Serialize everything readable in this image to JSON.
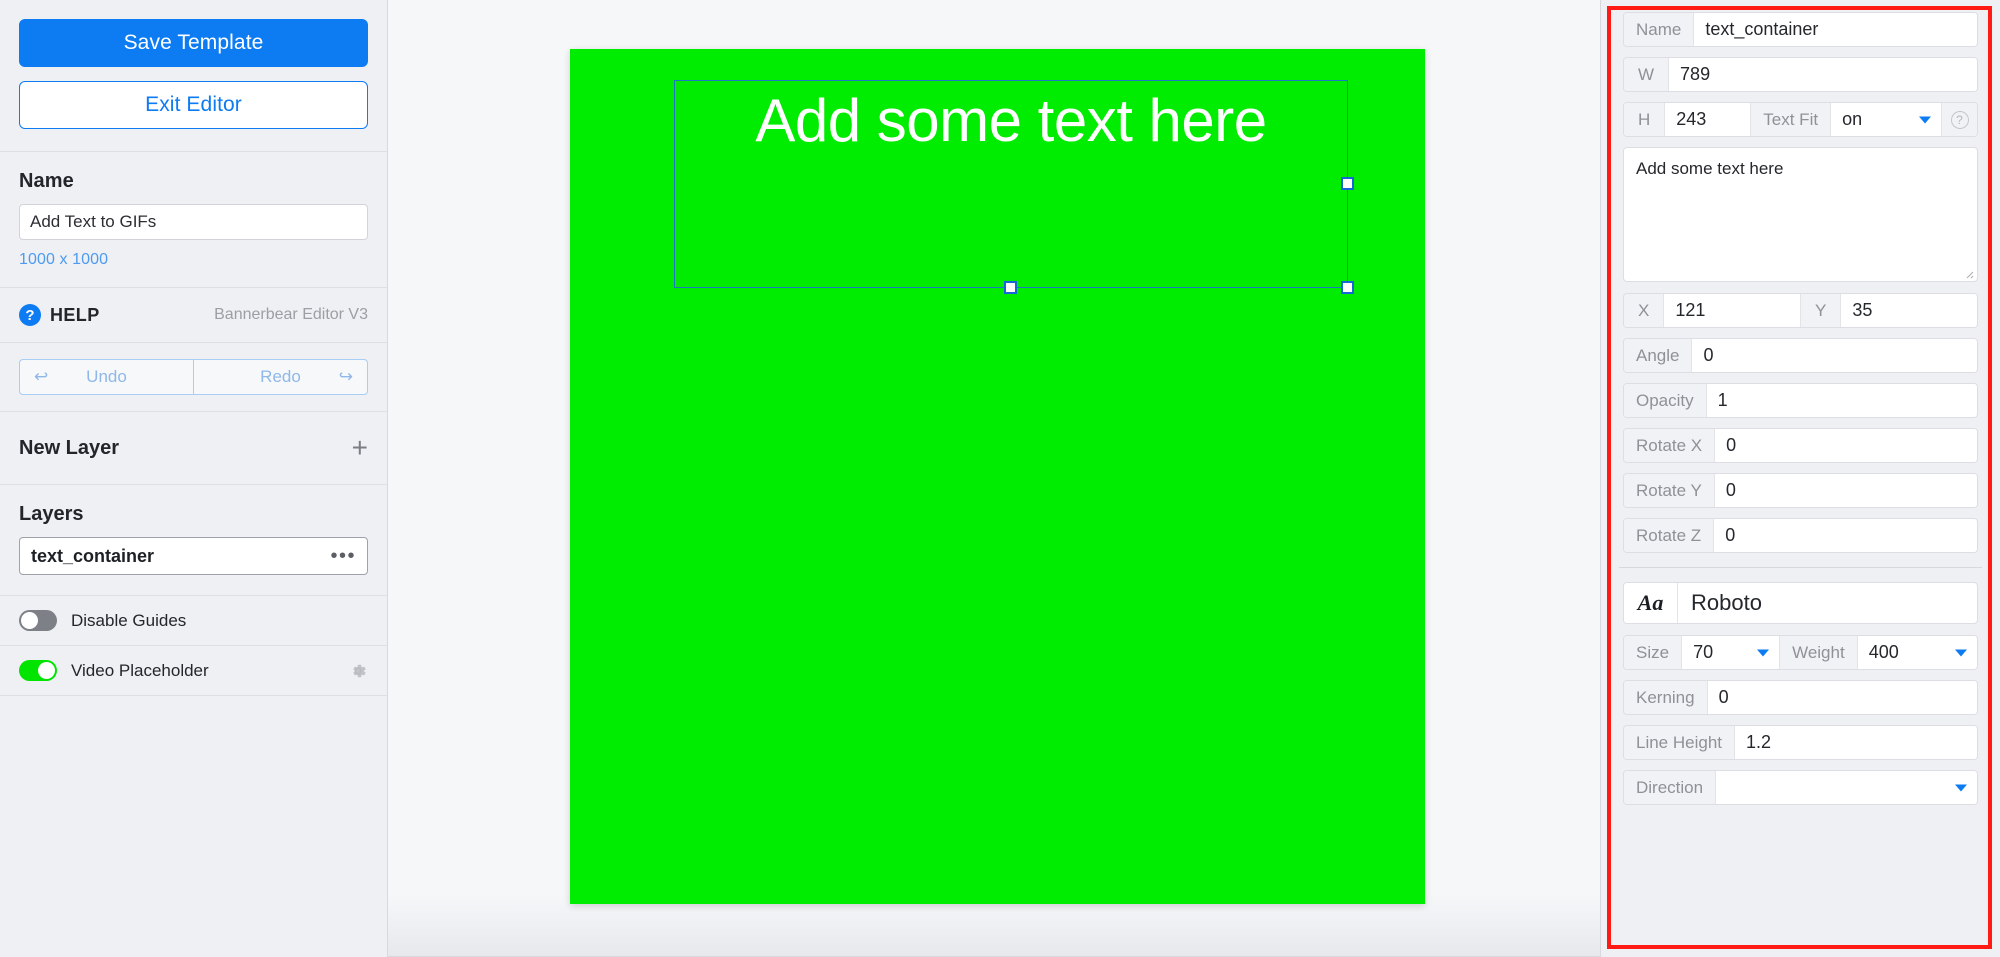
{
  "sidebar": {
    "save_template_label": "Save Template",
    "exit_editor_label": "Exit Editor",
    "name_heading": "Name",
    "name_value": "Add Text to GIFs",
    "dimensions": "1000 x 1000",
    "help_label": "HELP",
    "help_icon_glyph": "?",
    "editor_version": "Bannerbear Editor V3",
    "undo_label": "Undo",
    "redo_label": "Redo",
    "undo_icon_glyph": "↩",
    "redo_icon_glyph": "↪",
    "new_layer_label": "New Layer",
    "add_layer_glyph": "+",
    "layers_heading": "Layers",
    "layers": [
      {
        "name": "text_container",
        "menu_glyph": "•••"
      }
    ],
    "toggles": [
      {
        "label": "Disable Guides",
        "state": "off"
      },
      {
        "label": "Video Placeholder",
        "state": "on"
      }
    ]
  },
  "canvas": {
    "artboard_color": "#00ec00",
    "text_content": "Add some text here",
    "text_color": "#ffffff",
    "selection_border_color": "#1d79c4"
  },
  "properties": {
    "name_label": "Name",
    "name_value": "text_container",
    "w_label": "W",
    "w_value": "789",
    "h_label": "H",
    "h_value": "243",
    "text_fit_label": "Text Fit",
    "text_fit_value": "on",
    "help_glyph": "?",
    "text_value": "Add some text here",
    "x_label": "X",
    "x_value": "121",
    "y_label": "Y",
    "y_value": "35",
    "angle_label": "Angle",
    "angle_value": "0",
    "opacity_label": "Opacity",
    "opacity_value": "1",
    "rotate_x_label": "Rotate X",
    "rotate_x_value": "0",
    "rotate_y_label": "Rotate Y",
    "rotate_y_value": "0",
    "rotate_z_label": "Rotate Z",
    "rotate_z_value": "0"
  },
  "typography": {
    "font_icon_glyph": "Aa",
    "font_family_value": "Roboto",
    "size_label": "Size",
    "size_value": "70",
    "weight_label": "Weight",
    "weight_value": "400",
    "kerning_label": "Kerning",
    "kerning_value": "0",
    "line_height_label": "Line Height",
    "line_height_value": "1.2",
    "direction_label": "Direction",
    "direction_value": ""
  },
  "colors": {
    "accent_blue": "#0d7bf2",
    "green": "#00ec00",
    "annotation_red": "#ff1a13"
  }
}
